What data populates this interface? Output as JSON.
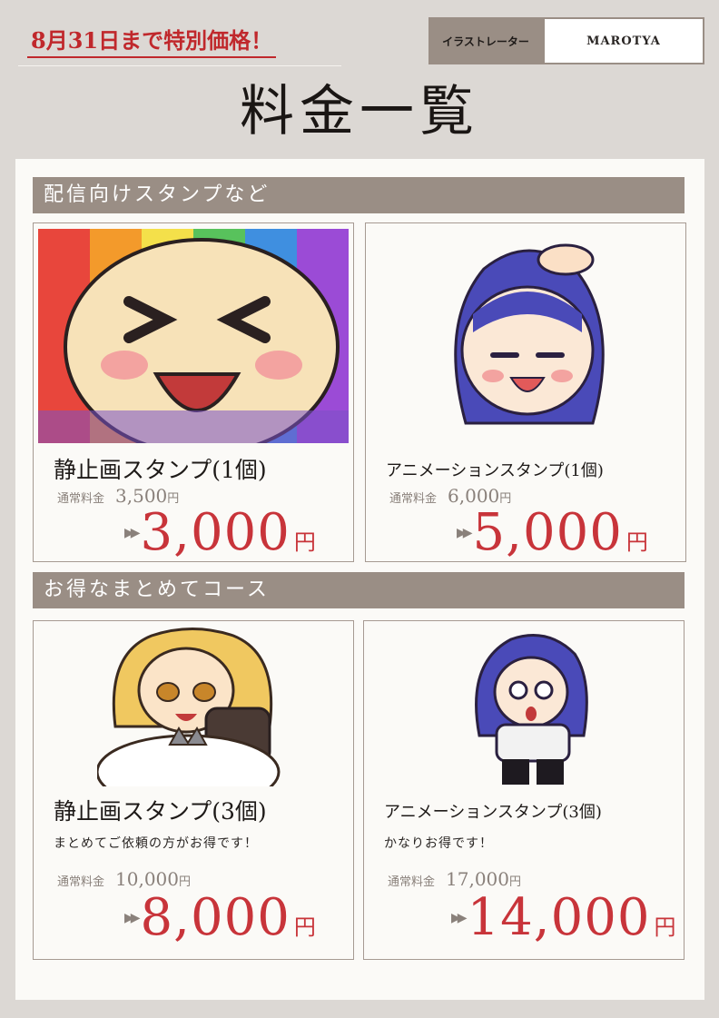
{
  "promo": "8月31日まで特別価格！",
  "artist": {
    "label": "イラストレーター",
    "name": "MAROTYA"
  },
  "title": "料金一覧",
  "sections": [
    {
      "heading": "配信向けスタンプなど"
    },
    {
      "heading": "お得なまとめてコース"
    }
  ],
  "cards": [
    {
      "title": "静止画スタンプ(1個)",
      "desc": "",
      "regular_label": "通常料金",
      "regular_price": "3,500",
      "yen": "円",
      "sale_price": "3,000",
      "sale_yen": "円",
      "arrow": "▶▶"
    },
    {
      "title": "アニメーションスタンプ(1個)",
      "desc": "",
      "regular_label": "通常料金",
      "regular_price": "6,000",
      "yen": "円",
      "sale_price": "5,000",
      "sale_yen": "円",
      "arrow": "▶▶"
    },
    {
      "title": "静止画スタンプ(3個)",
      "desc": "まとめてご依頼の方がお得です！",
      "regular_label": "通常料金",
      "regular_price": "10,000",
      "yen": "円",
      "sale_price": "8,000",
      "sale_yen": "円",
      "arrow": "▶▶"
    },
    {
      "title": "アニメーションスタンプ(3個)",
      "desc": "かなりお得です！",
      "regular_label": "通常料金",
      "regular_price": "17,000",
      "yen": "円",
      "sale_price": "14,000",
      "sale_yen": "円",
      "arrow": "▶▶"
    }
  ],
  "colors": {
    "accent": "#c8343a",
    "bar": "#9a8e85",
    "background": "#dcd8d4",
    "panel": "#fbfaf7"
  }
}
